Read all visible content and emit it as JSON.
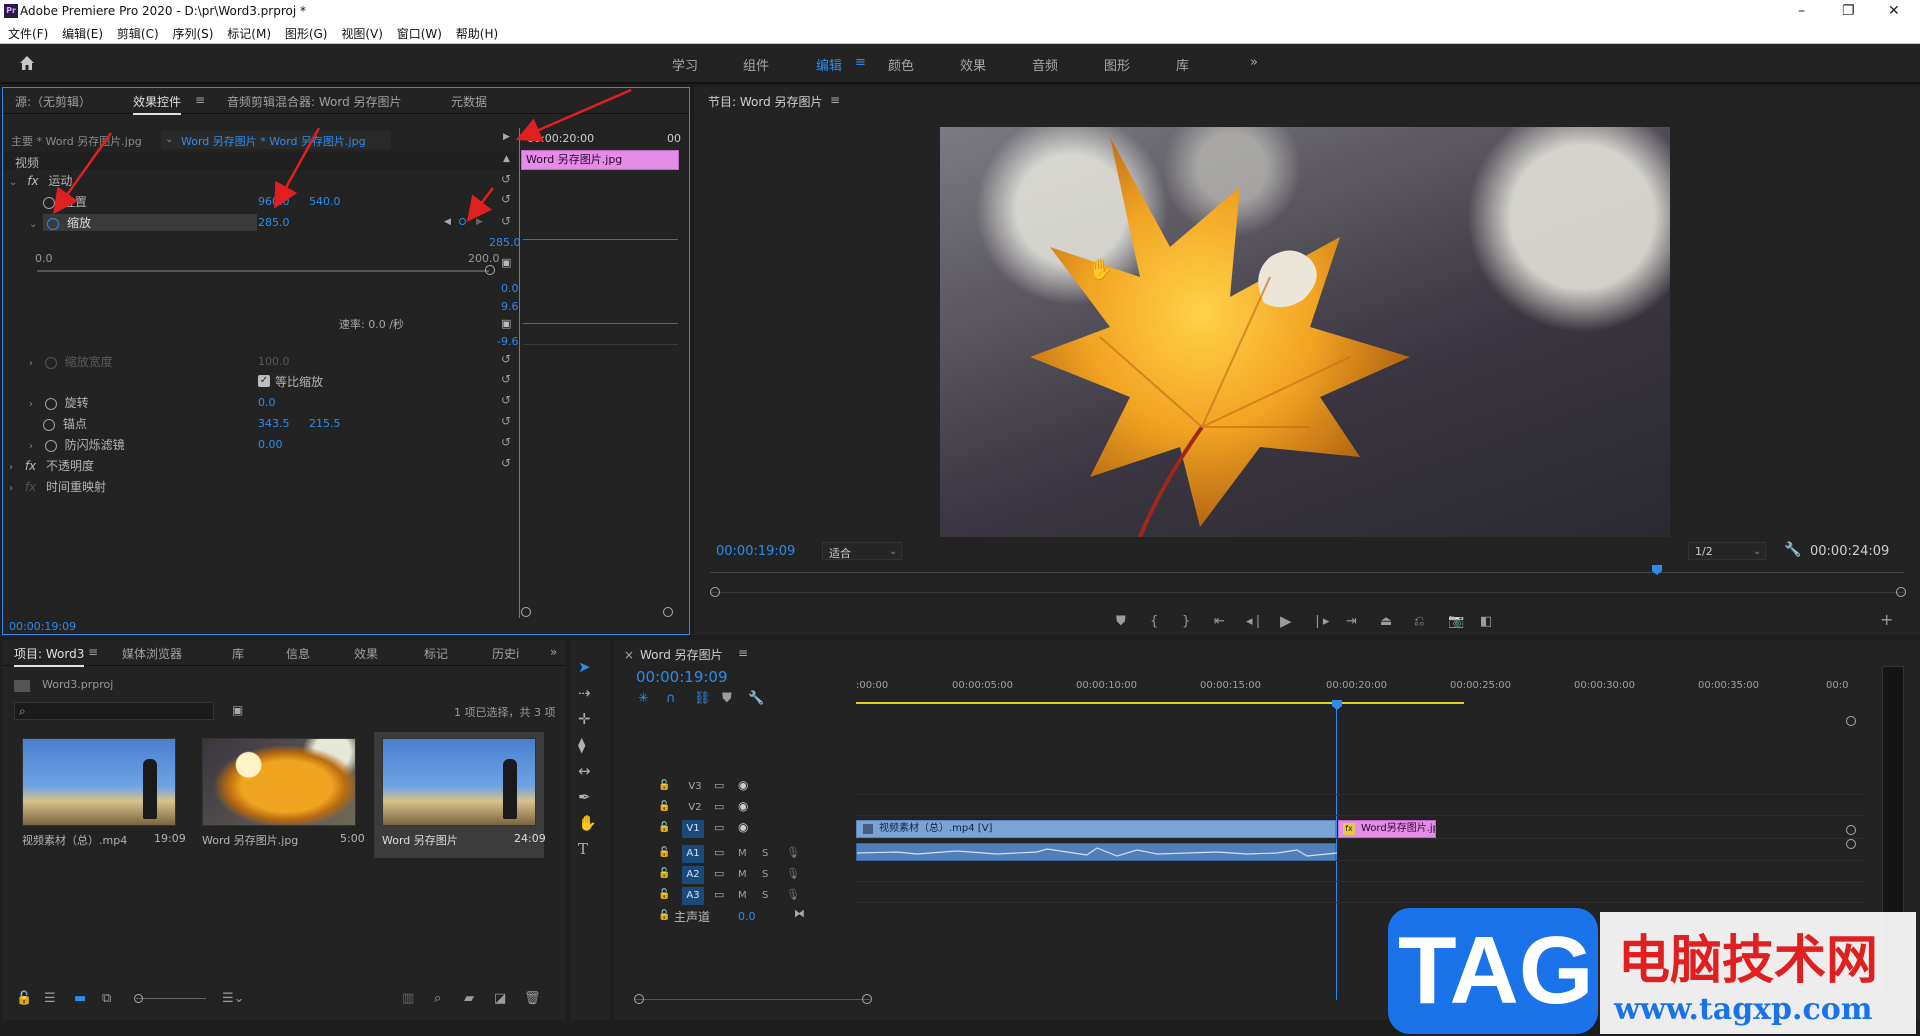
{
  "window": {
    "title": "Adobe Premiere Pro 2020 - D:\\pr\\Word3.prproj *",
    "logo": "Pr",
    "minimize": "–",
    "restore": "❐",
    "close": "✕"
  },
  "menu": [
    "文件(F)",
    "编辑(E)",
    "剪辑(C)",
    "序列(S)",
    "标记(M)",
    "图形(G)",
    "视图(V)",
    "窗口(W)",
    "帮助(H)"
  ],
  "workspaces": {
    "items": [
      "学习",
      "组件",
      "编辑",
      "颜色",
      "效果",
      "音频",
      "图形",
      "库"
    ],
    "active": "编辑",
    "more": "»",
    "menu_glyph": "≡"
  },
  "effects_panel": {
    "tabs": [
      "源:（无剪辑）",
      "效果控件",
      "音频剪辑混合器: Word 另存图片",
      "元数据"
    ],
    "master_label": "主要 * Word 另存图片.jpg",
    "clip_label": "Word 另存图片 * Word 另存图片.jpg",
    "timecode_top": "00:00:20:00",
    "timecode_top_right": "00",
    "clip_name": "Word 另存图片.jpg",
    "section_video": "视频",
    "motion": "运动",
    "position_label": "位置",
    "position_x": "960.0",
    "position_y": "540.0",
    "scale_label": "缩放",
    "scale_value": "285.0",
    "scale_range_min": "0.0",
    "scale_range_max": "200.0",
    "graph_val_top": "285.0",
    "graph_val_2": "0.0",
    "graph_val_3": "9.6",
    "graph_val_4": "-9.6",
    "velocity": "速率: 0.0 /秒",
    "scale_width_label": "缩放宽度",
    "scale_width_value": "100.0",
    "uniform_scale": "等比缩放",
    "rotation_label": "旋转",
    "rotation_value": "0.0",
    "anchor_label": "锚点",
    "anchor_x": "343.5",
    "anchor_y": "215.5",
    "antiflicker_label": "防闪烁滤镜",
    "antiflicker_value": "0.00",
    "opacity_label": "不透明度",
    "time_remap_label": "时间重映射",
    "timecode_bottom": "00:00:19:09"
  },
  "program_monitor": {
    "title": "节目: Word 另存图片",
    "timecode_current": "00:00:19:09",
    "fit": "适合",
    "resolution": "1/2",
    "timecode_duration": "00:00:24:09"
  },
  "project_panel": {
    "tabs": [
      "项目: Word3",
      "媒体浏览器",
      "库",
      "信息",
      "效果",
      "标记",
      "历史i"
    ],
    "file": "Word3.prproj",
    "selection_info": "1 项已选择，共 3 项",
    "items": [
      {
        "name": "视频素材（总）.mp4",
        "duration": "19:09"
      },
      {
        "name": "Word 另存图片.jpg",
        "duration": "5:00"
      },
      {
        "name": "Word 另存图片",
        "duration": "24:09"
      }
    ]
  },
  "timeline": {
    "title": "Word 另存图片",
    "timecode": "00:00:19:09",
    "ruler": [
      ":00:00",
      "00:00:05:00",
      "00:00:10:00",
      "00:00:15:00",
      "00:00:20:00",
      "00:00:25:00",
      "00:00:30:00",
      "00:00:35:00",
      "00:0"
    ],
    "video_tracks": [
      "V3",
      "V2",
      "V1"
    ],
    "audio_tracks": [
      "A1",
      "A2",
      "A3"
    ],
    "track_m": "M",
    "track_s": "S",
    "master": "主声道",
    "master_value": "0.0",
    "clip_video": "视频素材（总）.mp4 [V]",
    "clip_image": "Word另存图片.jpg",
    "fx_badge": "fx"
  },
  "watermark": {
    "tag": "TAG",
    "site_cn": "电脑技术网",
    "url": "www.tagxp.com"
  },
  "colors": {
    "accent": "#2d8ceb",
    "clip_pink": "#e58be8",
    "clip_blue": "#7aa4d6",
    "arrow": "#e02020"
  }
}
